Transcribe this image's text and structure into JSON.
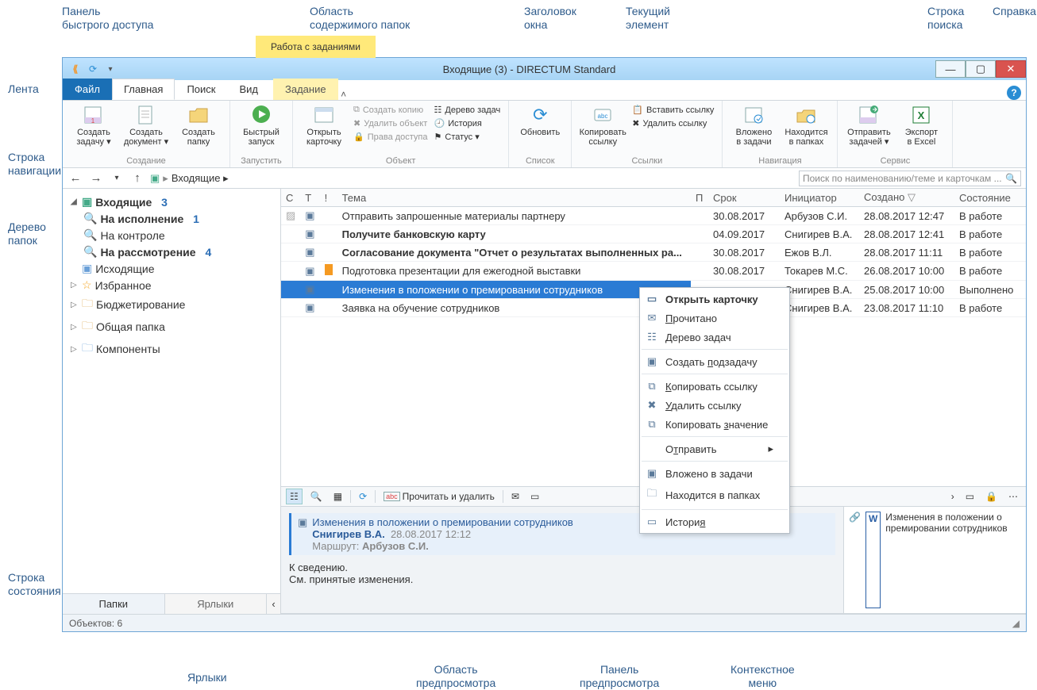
{
  "callouts": {
    "qa": "Панель\nбыстрого доступа",
    "content_area": "Область\nсодержимого папок",
    "title": "Заголовок\nокна",
    "current": "Текущий\nэлемент",
    "search": "Строка\nпоиска",
    "help": "Справка",
    "ribbon": "Лента",
    "navrow": "Строка\nнавигации",
    "tree": "Дерево\nпапок",
    "status": "Строка\nсостояния",
    "shortcuts": "Ярлыки",
    "preview_area": "Область\nпредпросмотра",
    "preview_panel": "Панель\nпредпросмотра",
    "ctx": "Контекстное\nменю"
  },
  "window": {
    "title": "Входящие (3) - DIRECTUM Standard"
  },
  "ribbon": {
    "context_header": "Работа с заданиями",
    "tabs": {
      "file": "Файл",
      "home": "Главная",
      "search": "Поиск",
      "view": "Вид",
      "task": "Задание"
    },
    "groups": {
      "create": "Создание",
      "run": "Запустить",
      "object": "Объект",
      "list": "Список",
      "links": "Ссылки",
      "nav": "Навигация",
      "service": "Сервис"
    },
    "btns": {
      "create_task": "Создать\nзадачу ▾",
      "create_doc": "Создать\nдокумент ▾",
      "create_folder": "Создать\nпапку",
      "quick_run": "Быстрый\nзапуск",
      "open_card": "Открыть\nкарточку",
      "copy": "Создать копию",
      "del_obj": "Удалить объект",
      "rights": "Права доступа",
      "task_tree": "Дерево задач",
      "history": "История",
      "status": "Статус ▾",
      "refresh": "Обновить",
      "copy_link": "Копировать\nссылку",
      "paste_link": "Вставить ссылку",
      "del_link": "Удалить ссылку",
      "in_tasks": "Вложено\nв задачи",
      "in_folders": "Находится\nв папках",
      "send_tasks": "Отправить\nзадачей ▾",
      "export_xls": "Экспорт\nв Excel"
    }
  },
  "nav": {
    "crumb": "Входящие ▸"
  },
  "search": {
    "placeholder": "Поиск по наименованию/теме и карточкам ..."
  },
  "tree": {
    "inbox": "Входящие",
    "inbox_cnt": "3",
    "exec": "На исполнение",
    "exec_cnt": "1",
    "control": "На контроле",
    "review": "На рассмотрение",
    "review_cnt": "4",
    "outbox": "Исходящие",
    "fav": "Избранное",
    "budget": "Бюджетирование",
    "shared": "Общая папка",
    "comp": "Компоненты",
    "tab_folders": "Папки",
    "tab_shortcuts": "Ярлыки"
  },
  "grid": {
    "cols": {
      "c": "С",
      "t": "Т",
      "f": "!",
      "subj": "Тема",
      "p": "П",
      "due": "Срок",
      "init": "Инициатор",
      "created": "Создано",
      "state": "Состояние"
    },
    "rows": [
      {
        "subj": "Отправить запрошенные материалы партнеру",
        "due": "30.08.2017",
        "init": "Арбузов С.И.",
        "created": "28.08.2017 12:47",
        "state": "В работе",
        "bold": false
      },
      {
        "subj": "Получите банковскую карту",
        "due": "04.09.2017",
        "init": "Снигирев В.А.",
        "created": "28.08.2017 12:41",
        "state": "В работе",
        "bold": true
      },
      {
        "subj": "Согласование документа \"Отчет о результатах выполненных ра...",
        "due": "30.08.2017",
        "init": "Ежов В.Л.",
        "created": "28.08.2017 11:11",
        "state": "В работе",
        "bold": true
      },
      {
        "subj": "Подготовка презентации для ежегодной выставки",
        "due": "30.08.2017",
        "init": "Токарев М.С.",
        "created": "26.08.2017 10:00",
        "state": "В работе",
        "bold": false,
        "flag": true
      },
      {
        "subj": "Изменения в положении о премировании сотрудников",
        "due": "",
        "init": "Снигирев В.А.",
        "created": "25.08.2017 10:00",
        "state": "Выполнено",
        "bold": false,
        "sel": true
      },
      {
        "subj": "Заявка на обучение сотрудников",
        "due": "",
        "init": "Снигирев В.А.",
        "created": "23.08.2017 11:10",
        "state": "В работе",
        "bold": false
      }
    ]
  },
  "preview": {
    "toolbar_read_delete": "Прочитать и удалить",
    "subject": "Изменения в положении о премировании сотрудников",
    "author": "Снигирев В.А.",
    "ts": "28.08.2017 12:12",
    "route_lbl": "Маршрут:",
    "route_val": "Арбузов С.И.",
    "body1": "К сведению.",
    "body2": "См. принятые изменения.",
    "attach": "Изменения в положении о премировании сотрудников"
  },
  "ctx": {
    "open": "Открыть карточку",
    "read": "Прочитано",
    "tree": "Дерево задач",
    "subtask": "Создать подзадачу",
    "copylink": "Копировать ссылку",
    "dellink": "Удалить ссылку",
    "copyval": "Копировать значение",
    "send": "Отправить",
    "intasks": "Вложено в задачи",
    "infolders": "Находится в папках",
    "history": "История"
  },
  "status": {
    "objects": "Объектов: 6"
  }
}
